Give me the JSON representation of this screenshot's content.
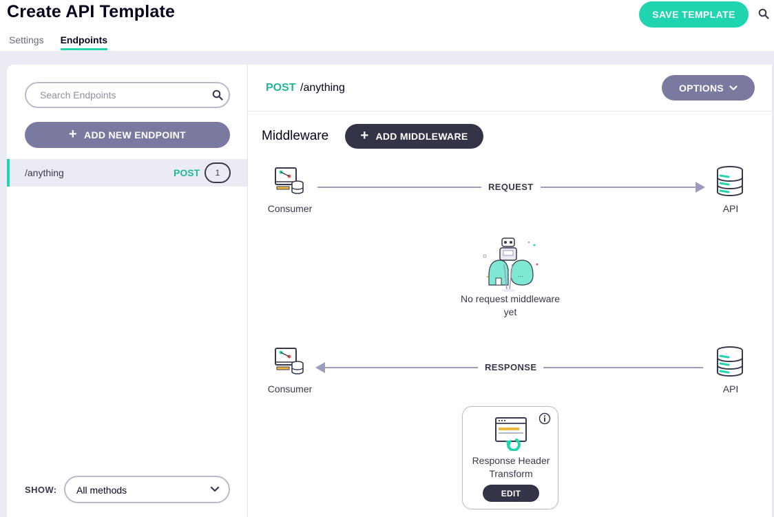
{
  "header": {
    "title": "Create API Template",
    "save_label": "SAVE TEMPLATE",
    "search_icon": "search-icon"
  },
  "tabs": [
    {
      "label": "Settings",
      "active": false
    },
    {
      "label": "Endpoints",
      "active": true
    }
  ],
  "colors": {
    "accent": "#20d4b0",
    "method_post": "#20b894",
    "secondary_button": "#7a7aa0",
    "dark_button": "#343449",
    "background": "#ebebf3"
  },
  "sidebar": {
    "search_placeholder": "Search Endpoints",
    "add_endpoint_label": "ADD NEW ENDPOINT",
    "endpoints": [
      {
        "path": "/anything",
        "method": "POST",
        "count": "1",
        "selected": true
      }
    ],
    "show_label": "SHOW:",
    "show_value": "All methods"
  },
  "detail": {
    "method": "POST",
    "path": "/anything",
    "options_label": "OPTIONS",
    "middleware_title": "Middleware",
    "add_middleware_label": "ADD MIDDLEWARE",
    "request": {
      "consumer_label": "Consumer",
      "api_label": "API",
      "label": "REQUEST",
      "empty_text": "No request middleware yet"
    },
    "response": {
      "consumer_label": "Consumer",
      "api_label": "API",
      "label": "RESPONSE",
      "middleware": [
        {
          "title": "Response Header Transform",
          "edit_label": "EDIT",
          "icon": "response-header-transform-icon"
        }
      ]
    }
  }
}
